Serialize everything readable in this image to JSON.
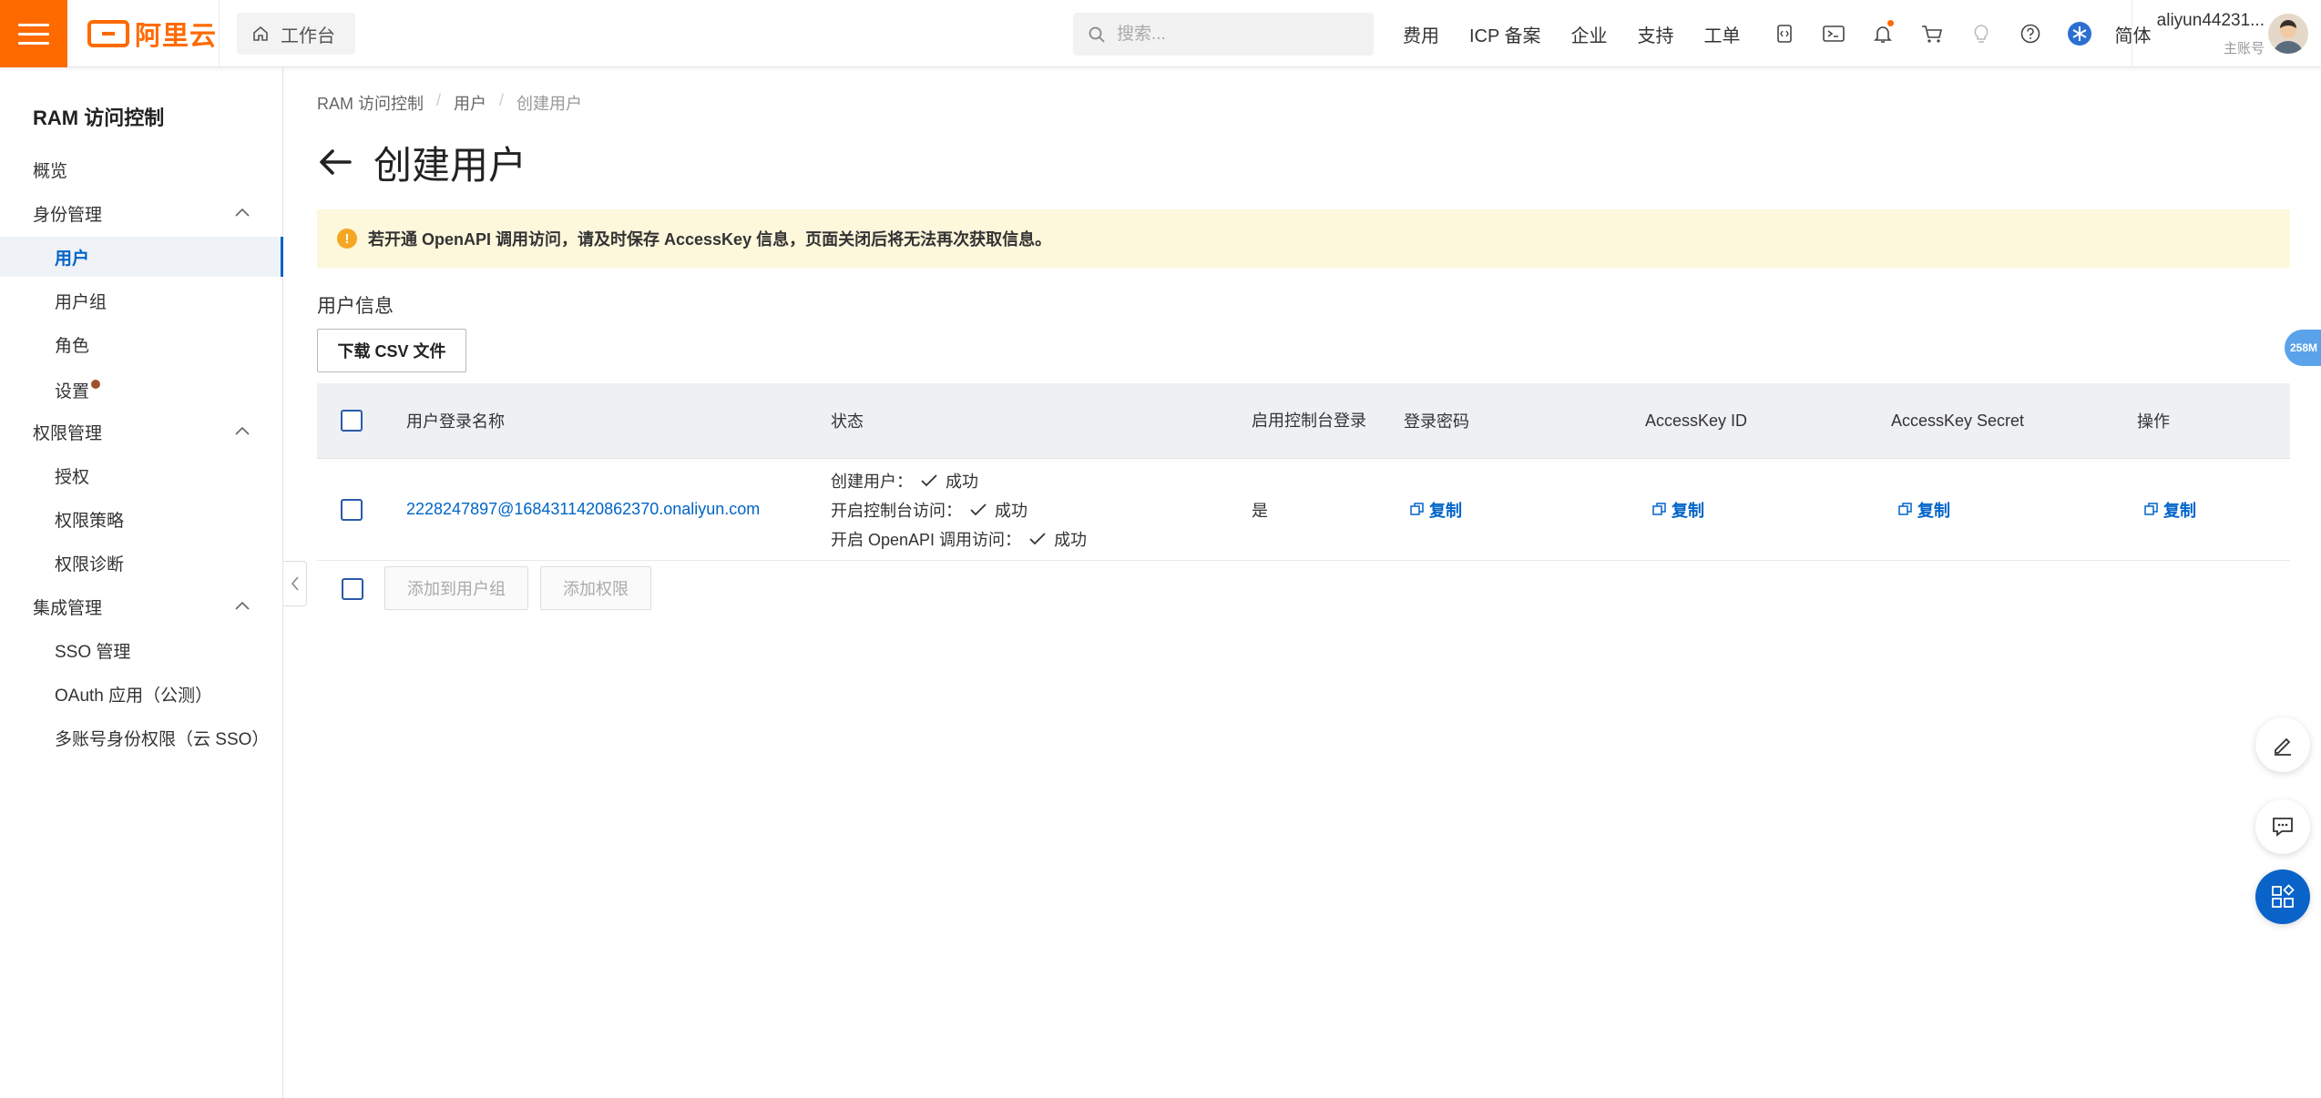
{
  "topbar": {
    "brand": "阿里云",
    "workbench_label": "工作台",
    "search_placeholder": "搜索...",
    "nav": [
      "费用",
      "ICP 备案",
      "企业",
      "支持",
      "工单"
    ],
    "lang": "简体",
    "username": "aliyun44231...",
    "account_role": "主账号"
  },
  "sidebar": {
    "title": "RAM 访问控制",
    "overview": "概览",
    "identity_group": "身份管理",
    "users": "用户",
    "user_groups": "用户组",
    "roles": "角色",
    "settings": "设置",
    "permission_group": "权限管理",
    "grant": "授权",
    "policies": "权限策略",
    "diagnosis": "权限诊断",
    "integration_group": "集成管理",
    "sso": "SSO 管理",
    "oauth": "OAuth 应用（公测）",
    "multi_account": "多账号身份权限（云 SSO）"
  },
  "breadcrumb": {
    "root": "RAM 访问控制",
    "parent": "用户",
    "current": "创建用户"
  },
  "page": {
    "title": "创建用户",
    "alert": "若开通 OpenAPI 调用访问，请及时保存 AccessKey 信息，页面关闭后将无法再次获取信息。",
    "section_title": "用户信息",
    "download_csv": "下载 CSV 文件"
  },
  "table": {
    "headers": {
      "login_name": "用户登录名称",
      "status": "状态",
      "console_login": "启用控制台登录",
      "password": "登录密码",
      "ak_id": "AccessKey ID",
      "ak_secret": "AccessKey Secret",
      "action": "操作"
    },
    "rows": [
      {
        "login_name": "2228247897@1684311420862370.onaliyun.com",
        "status": [
          {
            "label": "创建用户：",
            "result": "成功"
          },
          {
            "label": "开启控制台访问：",
            "result": "成功"
          },
          {
            "label": "开启 OpenAPI 调用访问：",
            "result": "成功"
          }
        ],
        "console_login": "是",
        "copy_label": "复制"
      }
    ],
    "footer": {
      "add_to_group": "添加到用户组",
      "add_permission": "添加权限"
    }
  },
  "widgets": {
    "memory_badge": "258M"
  },
  "colors": {
    "brand_orange": "#ff6a00",
    "link_blue": "#0064c8",
    "alert_bg": "#fdf7dc"
  }
}
